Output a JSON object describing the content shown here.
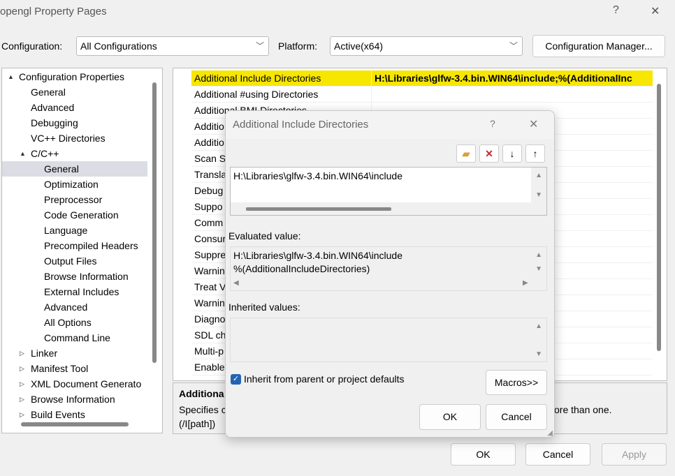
{
  "window": {
    "title": "opengl Property Pages",
    "help": "?",
    "close": "✕"
  },
  "config": {
    "label": "Configuration:",
    "value": "All Configurations",
    "platform_label": "Platform:",
    "platform_value": "Active(x64)",
    "manager_button": "Configuration Manager..."
  },
  "tree": [
    {
      "label": "Configuration Properties",
      "level": 0,
      "expander": "▲"
    },
    {
      "label": "General",
      "level": 1
    },
    {
      "label": "Advanced",
      "level": 1
    },
    {
      "label": "Debugging",
      "level": 1
    },
    {
      "label": "VC++ Directories",
      "level": 1
    },
    {
      "label": "C/C++",
      "level": 1,
      "expander": "▲"
    },
    {
      "label": "General",
      "level": 2,
      "selected": true
    },
    {
      "label": "Optimization",
      "level": 2
    },
    {
      "label": "Preprocessor",
      "level": 2
    },
    {
      "label": "Code Generation",
      "level": 2
    },
    {
      "label": "Language",
      "level": 2
    },
    {
      "label": "Precompiled Headers",
      "level": 2
    },
    {
      "label": "Output Files",
      "level": 2
    },
    {
      "label": "Browse Information",
      "level": 2
    },
    {
      "label": "External Includes",
      "level": 2
    },
    {
      "label": "Advanced",
      "level": 2
    },
    {
      "label": "All Options",
      "level": 2
    },
    {
      "label": "Command Line",
      "level": 2
    },
    {
      "label": "Linker",
      "level": 1,
      "expander": "▷"
    },
    {
      "label": "Manifest Tool",
      "level": 1,
      "expander": "▷"
    },
    {
      "label": "XML Document Generato",
      "level": 1,
      "expander": "▷"
    },
    {
      "label": "Browse Information",
      "level": 1,
      "expander": "▷"
    },
    {
      "label": "Build Events",
      "level": 1,
      "expander": "▷"
    }
  ],
  "grid": [
    {
      "name": "Additional Include Directories",
      "value": "H:\\Libraries\\glfw-3.4.bin.WIN64\\include;%(AdditionalInc"
    },
    {
      "name": "Additional #using Directories",
      "value": ""
    },
    {
      "name": "Additional BMI Directories",
      "value": ""
    },
    {
      "name": "Additio",
      "value": ""
    },
    {
      "name": "Additio",
      "value": ""
    },
    {
      "name": "Scan S",
      "value": ""
    },
    {
      "name": "Transla",
      "value": ""
    },
    {
      "name": "Debug",
      "value": ""
    },
    {
      "name": "Suppo",
      "value": ""
    },
    {
      "name": "Comm",
      "value": ""
    },
    {
      "name": "Consur",
      "value": ""
    },
    {
      "name": "Suppre",
      "value": ""
    },
    {
      "name": "Warnin",
      "value": ""
    },
    {
      "name": "Treat V",
      "value": ""
    },
    {
      "name": "Warnin",
      "value": ""
    },
    {
      "name": "Diagno",
      "value": ""
    },
    {
      "name": "SDL ch",
      "value": ""
    },
    {
      "name": "Multi-p",
      "value": ""
    },
    {
      "name": "Enable",
      "value": ""
    }
  ],
  "description": {
    "title": "Additiona",
    "line1_start": "Specifies c",
    "line1_end": "ore than one.",
    "line2": "(/I[path])"
  },
  "footer": {
    "ok": "OK",
    "cancel": "Cancel",
    "apply": "Apply"
  },
  "dialog": {
    "title": "Additional Include Directories",
    "help": "?",
    "close": "✕",
    "entries": [
      "H:\\Libraries\\glfw-3.4.bin.WIN64\\include"
    ],
    "evaluated_label": "Evaluated value:",
    "evaluated": [
      "H:\\Libraries\\glfw-3.4.bin.WIN64\\include",
      "%(AdditionalIncludeDirectories)"
    ],
    "inherited_label": "Inherited values:",
    "inherit_checkbox": "Inherit from parent or project defaults",
    "inherit_checked": true,
    "macros": "Macros>>",
    "ok": "OK",
    "cancel": "Cancel"
  },
  "colors": {
    "highlight": "#f7e600",
    "checkbox": "#2463b0"
  }
}
